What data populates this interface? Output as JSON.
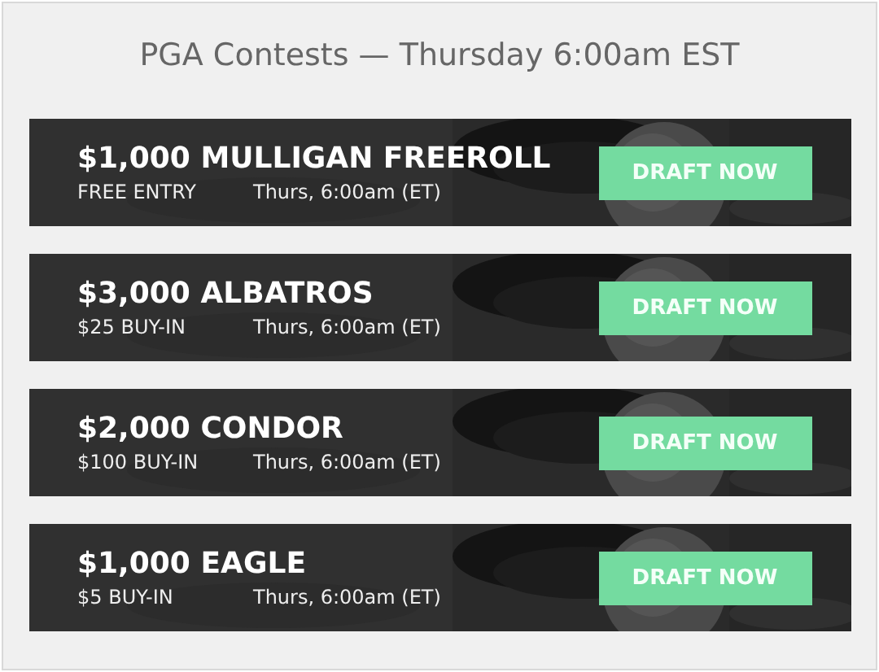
{
  "heading": "PGA Contests — Thursday 6:00am EST",
  "contests": [
    {
      "title": "$1,000 MULLIGAN FREEROLL",
      "entry": "FREE ENTRY",
      "time": "Thurs, 6:00am (ET)",
      "button": "DRAFT NOW"
    },
    {
      "title": "$3,000 ALBATROS",
      "entry": "$25 BUY-IN",
      "time": "Thurs, 6:00am (ET)",
      "button": "DRAFT NOW"
    },
    {
      "title": "$2,000 CONDOR",
      "entry": "$100 BUY-IN",
      "time": "Thurs, 6:00am (ET)",
      "button": "DRAFT NOW"
    },
    {
      "title": "$1,000 EAGLE",
      "entry": "$5 BUY-IN",
      "time": "Thurs, 6:00am (ET)",
      "button": "DRAFT NOW"
    }
  ]
}
